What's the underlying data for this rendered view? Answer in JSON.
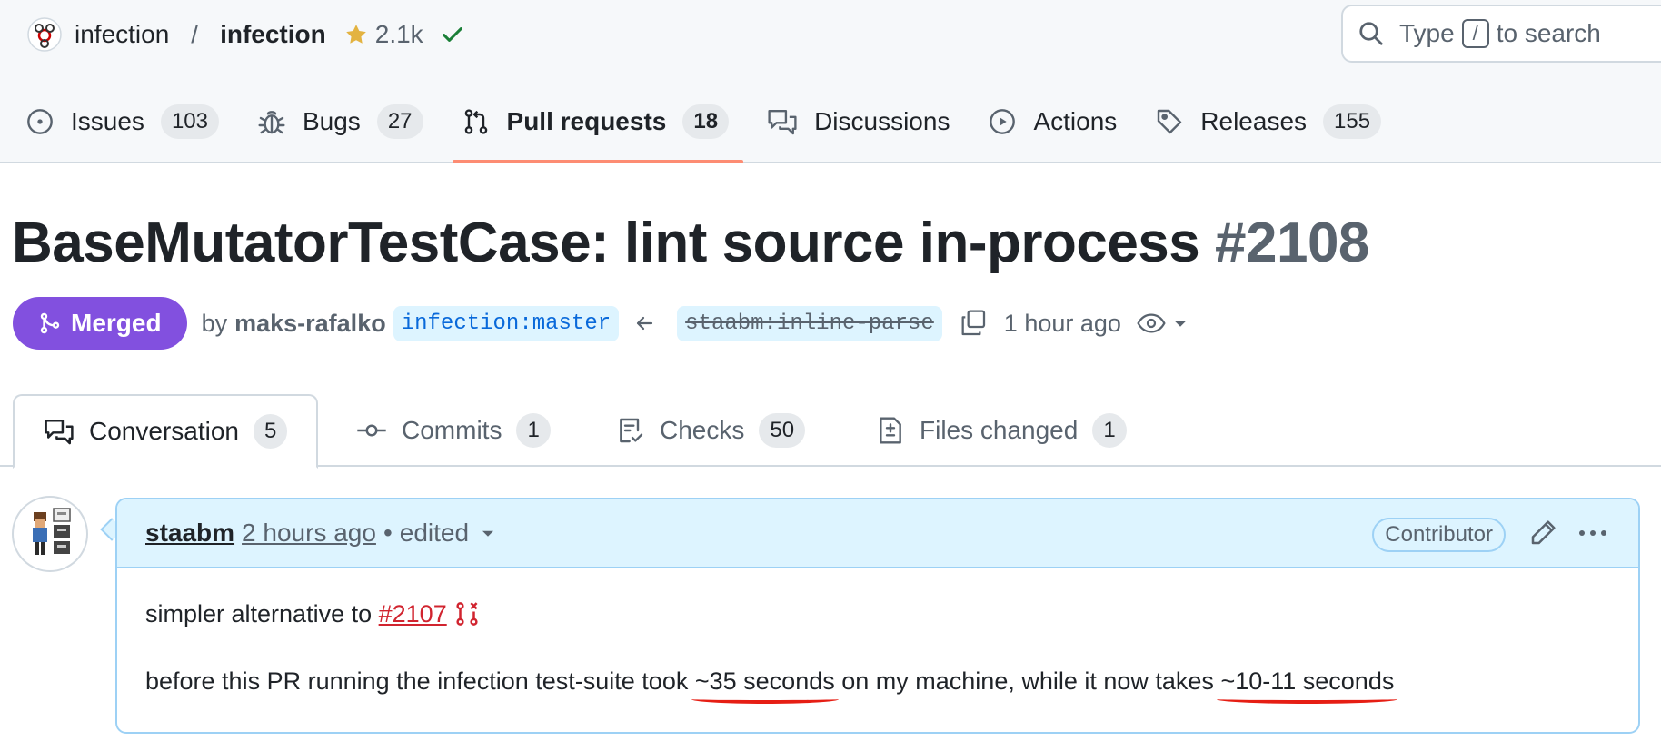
{
  "repo": {
    "owner": "infection",
    "separator": "/",
    "name": "infection",
    "stars": "2.1k"
  },
  "search": {
    "prefix": "Type",
    "key": "/",
    "suffix": "to search"
  },
  "nav": [
    {
      "label": "Issues",
      "count": "103",
      "icon": "issue-opened-icon"
    },
    {
      "label": "Bugs",
      "count": "27",
      "icon": "bug-icon"
    },
    {
      "label": "Pull requests",
      "count": "18",
      "icon": "git-pull-request-icon",
      "selected": true
    },
    {
      "label": "Discussions",
      "count": "",
      "icon": "comment-discussion-icon"
    },
    {
      "label": "Actions",
      "count": "",
      "icon": "play-icon"
    },
    {
      "label": "Releases",
      "count": "155",
      "icon": "tag-icon"
    }
  ],
  "pr": {
    "title": "BaseMutatorTestCase: lint source in-process",
    "number": "#2108",
    "state": "Merged",
    "by": "by",
    "author": "maks-rafalko",
    "base_branch": "infection:master",
    "head_branch": "staabm:inline-parse",
    "time": "1 hour ago"
  },
  "tabs": [
    {
      "label": "Conversation",
      "count": "5",
      "icon": "comment-discussion-icon",
      "selected": true
    },
    {
      "label": "Commits",
      "count": "1",
      "icon": "git-commit-icon"
    },
    {
      "label": "Checks",
      "count": "50",
      "icon": "checklist-icon"
    },
    {
      "label": "Files changed",
      "count": "1",
      "icon": "file-diff-icon"
    }
  ],
  "comment": {
    "author": "staabm",
    "time": "2 hours ago",
    "dot": "•",
    "edited": "edited",
    "role": "Contributor",
    "line1_prefix": "simpler alternative to",
    "line1_link": "#2107",
    "line2_part1": "before this PR running the infection test-suite took",
    "line2_hl1": "~35 seconds",
    "line2_part2": "on my machine, while it now takes",
    "line2_hl2": "~10-11 seconds"
  },
  "colors": {
    "merged": "#8250df",
    "accent_link": "#0969da",
    "closed_link": "#d1242f",
    "tab_underline": "#fd8c73",
    "annotation": "#e61e14"
  }
}
